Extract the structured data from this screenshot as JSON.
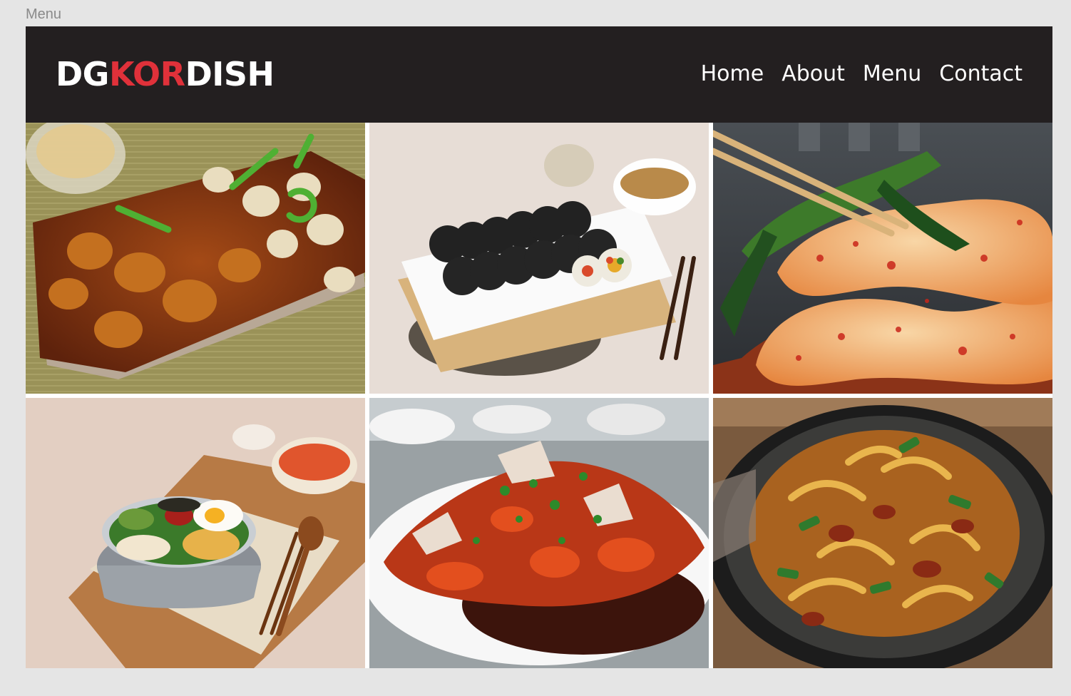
{
  "frame": {
    "label": "Menu"
  },
  "brand": {
    "prefix": "DG",
    "accent": "KOR",
    "suffix": "DISH",
    "accent_color": "#e0313a"
  },
  "nav": {
    "items": [
      {
        "label": "Home"
      },
      {
        "label": "About"
      },
      {
        "label": "Menu"
      },
      {
        "label": "Contact"
      }
    ]
  },
  "gallery": {
    "photos": [
      {
        "name": "braised-chicken-dish-photo"
      },
      {
        "name": "kimbap-platter-photo"
      },
      {
        "name": "kimchi-chopsticks-photo"
      },
      {
        "name": "bibimbap-bowl-photo"
      },
      {
        "name": "spicy-crab-dish-photo"
      },
      {
        "name": "stir-fry-pan-photo"
      }
    ]
  },
  "colors": {
    "navbar_bg": "#231f20",
    "page_bg": "#e5e5e5",
    "accent": "#e0313a"
  }
}
